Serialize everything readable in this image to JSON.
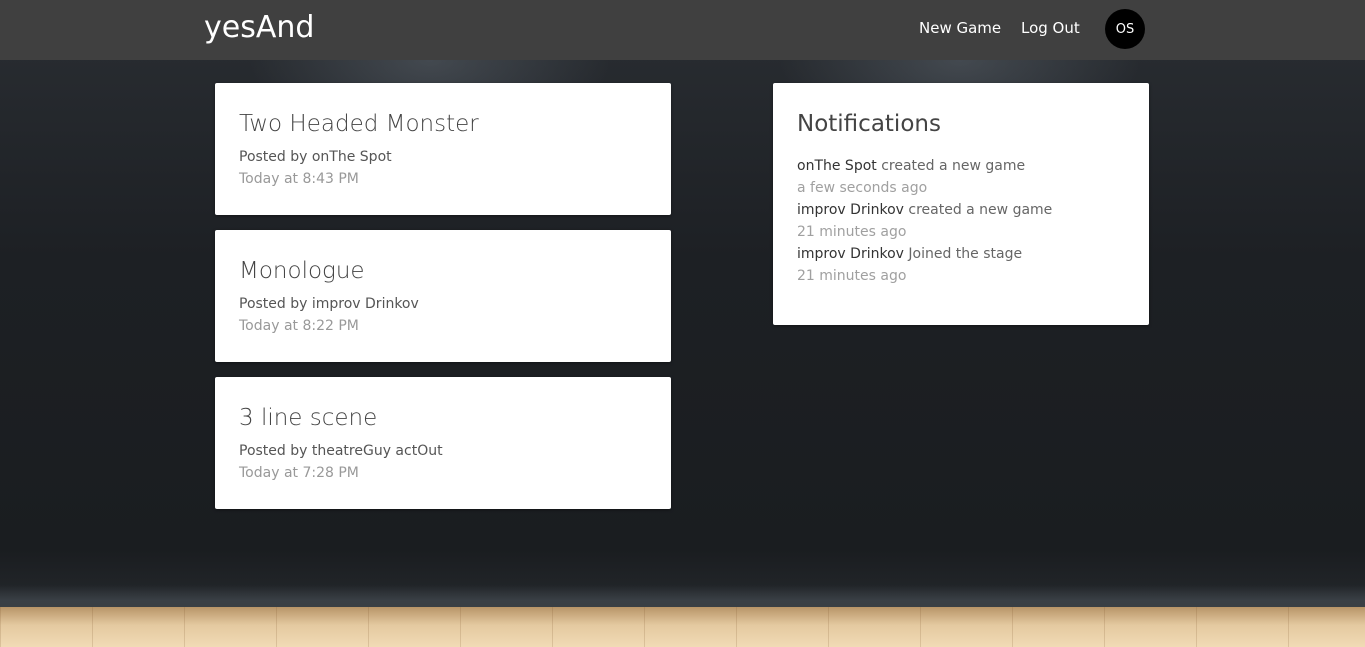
{
  "navbar": {
    "brand": "yesAnd",
    "new_game_label": "New Game",
    "logout_label": "Log Out",
    "avatar_initials": "OS"
  },
  "games": [
    {
      "title": "Two Headed Monster",
      "posted_by": "Posted by onThe Spot",
      "time": "Today at 8:43 PM"
    },
    {
      "title": "Monologue",
      "posted_by": "Posted by improv Drinkov",
      "time": "Today at 8:22 PM"
    },
    {
      "title": "3 line scene",
      "posted_by": "Posted by theatreGuy actOut",
      "time": "Today at 7:28 PM"
    }
  ],
  "notifications": {
    "title": "Notifications",
    "items": [
      {
        "actor": "onThe Spot",
        "action": " created a new game",
        "ago": "a few seconds ago"
      },
      {
        "actor": "improv Drinkov",
        "action": " created a new game",
        "ago": "21 minutes ago"
      },
      {
        "actor": "improv Drinkov",
        "action": " Joined the stage",
        "ago": "21 minutes ago"
      }
    ]
  },
  "colors": {
    "navbar": "#404040",
    "card": "#ffffff",
    "avatar": "#000000"
  }
}
